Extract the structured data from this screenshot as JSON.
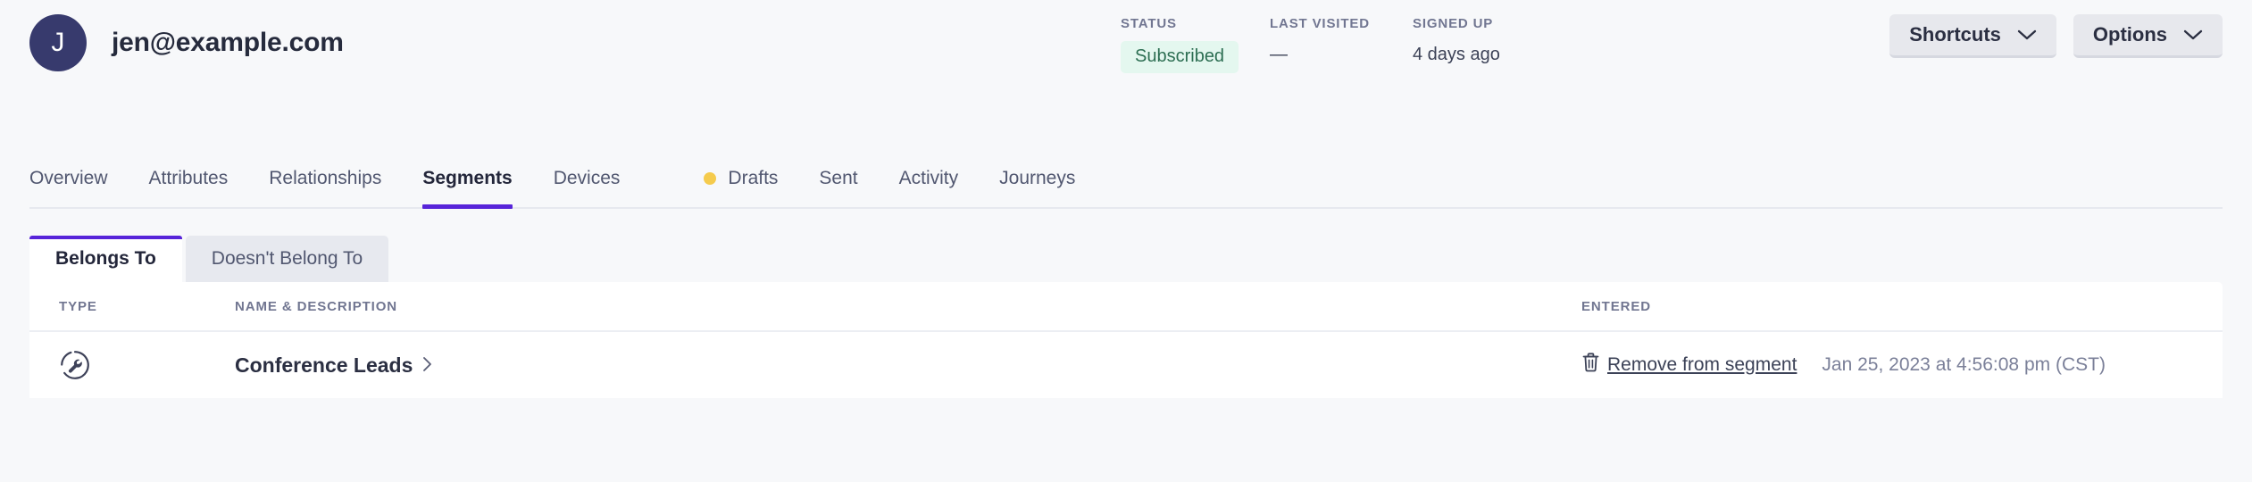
{
  "profile": {
    "avatar_initial": "J",
    "email": "jen@example.com",
    "avatar_color": "#373a6d"
  },
  "meta": {
    "status": {
      "label": "STATUS",
      "value": "Subscribed",
      "pill_bg": "#e4f7ef",
      "pill_color": "#2c6e52"
    },
    "last_visited": {
      "label": "LAST VISITED",
      "value": "—"
    },
    "signed_up": {
      "label": "SIGNED UP",
      "value": "4 days ago"
    }
  },
  "header_actions": [
    {
      "label": "Shortcuts",
      "icon": "chevron-down-icon"
    },
    {
      "label": "Options",
      "icon": "chevron-down-icon"
    }
  ],
  "tabs": [
    {
      "label": "Overview",
      "active": false,
      "dot": false
    },
    {
      "label": "Attributes",
      "active": false,
      "dot": false
    },
    {
      "label": "Relationships",
      "active": false,
      "dot": false
    },
    {
      "label": "Segments",
      "active": true,
      "dot": false
    },
    {
      "label": "Devices",
      "active": false,
      "dot": false
    },
    {
      "label": "Drafts",
      "active": false,
      "dot": true,
      "dot_color": "#f5cb4d"
    },
    {
      "label": "Sent",
      "active": false,
      "dot": false
    },
    {
      "label": "Activity",
      "active": false,
      "dot": false
    },
    {
      "label": "Journeys",
      "active": false,
      "dot": false
    }
  ],
  "subtabs": [
    {
      "label": "Belongs To",
      "active": true
    },
    {
      "label": "Doesn't Belong To",
      "active": false
    }
  ],
  "table": {
    "columns": [
      "TYPE",
      "NAME & DESCRIPTION",
      "ENTERED"
    ],
    "rows": [
      {
        "type_icon": "manual-segment-wrench-icon",
        "name": "Conference Leads",
        "name_chevron": "chevron-right-icon",
        "remove_icon": "trash-icon",
        "remove_label": "Remove from segment",
        "entered": "Jan 25, 2023 at 4:56:08 pm (CST)"
      }
    ]
  },
  "theme": {
    "accent": "#5724d9",
    "page_bg": "#f7f8fa",
    "card_bg": "#ffffff"
  }
}
